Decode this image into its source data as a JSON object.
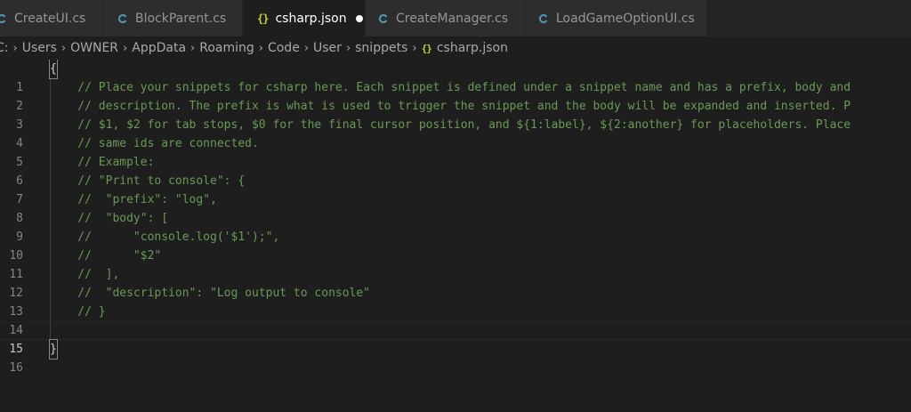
{
  "tabs": [
    {
      "label": "CreateUI.cs",
      "icon": "csharp-icon",
      "active": false
    },
    {
      "label": "BlockParent.cs",
      "icon": "csharp-icon",
      "active": false
    },
    {
      "label": "csharp.json",
      "icon": "json-icon",
      "active": true,
      "dirty": true
    },
    {
      "label": "CreateManager.cs",
      "icon": "csharp-icon",
      "active": false
    },
    {
      "label": "LoadGameOptionUI.cs",
      "icon": "csharp-icon",
      "active": false
    }
  ],
  "json_icon_glyph": "{}",
  "breadcrumb": [
    "C:",
    "Users",
    "OWNER",
    "AppData",
    "Roaming",
    "Code",
    "User",
    "snippets",
    "csharp.json"
  ],
  "breadcrumb_sep": "›",
  "lines": [
    {
      "n": "1",
      "text": "{"
    },
    {
      "n": "2",
      "text": "    // Place your snippets for csharp here. Each snippet is defined under a snippet name and has a prefix, body and"
    },
    {
      "n": "3",
      "text": "    // description. The prefix is what is used to trigger the snippet and the body will be expanded and inserted. P"
    },
    {
      "n": "4",
      "text": "    // $1, $2 for tab stops, $0 for the final cursor position, and ${1:label}, ${2:another} for placeholders. Place"
    },
    {
      "n": "5",
      "text": "    // same ids are connected."
    },
    {
      "n": "6",
      "text": "    // Example:"
    },
    {
      "n": "7",
      "text": "    // \"Print to console\": {"
    },
    {
      "n": "8",
      "text": "    //  \"prefix\": \"log\","
    },
    {
      "n": "9",
      "text": "    //  \"body\": ["
    },
    {
      "n": "10",
      "text": "    //      \"console.log('$1');\","
    },
    {
      "n": "11",
      "text": "    //      \"$2\""
    },
    {
      "n": "12",
      "text": "    //  ],"
    },
    {
      "n": "13",
      "text": "    //  \"description\": \"Log output to console\""
    },
    {
      "n": "14",
      "text": "    // }"
    },
    {
      "n": "15",
      "text": ""
    },
    {
      "n": "16",
      "text": "}"
    }
  ],
  "colors": {
    "comment": "#6a9955",
    "csharp_icon": "#519aba",
    "json_icon": "#cbcb41",
    "editor_bg": "#1e1e1e",
    "tab_bg": "#2d2d2d"
  }
}
